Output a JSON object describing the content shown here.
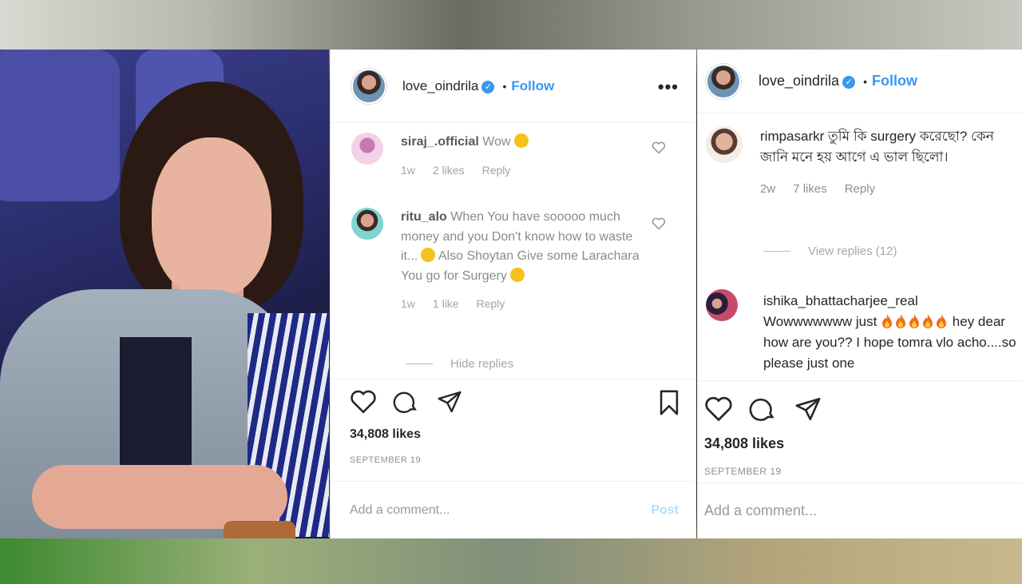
{
  "post": {
    "username": "love_oindrila",
    "follow_label": "Follow",
    "dot": "•",
    "likes": "34,808 likes",
    "date": "SEPTEMBER 19",
    "add_comment_placeholder": "Add a comment...",
    "post_label": "Post",
    "more_label": "•••",
    "verified_mark": "✓"
  },
  "left_comments": [
    {
      "user": "siraj_.official",
      "text": "Wow",
      "age": "1w",
      "likes": "2 likes",
      "reply": "Reply"
    },
    {
      "user": "ritu_alo",
      "text": "When You have sooooo much money and you Don't know how to waste it...",
      "text2": "Also Shoytan Give some Larachara You go for Surgery",
      "age": "1w",
      "likes": "1 like",
      "reply": "Reply"
    }
  ],
  "left_thread": {
    "label": "Hide replies"
  },
  "right_comments": [
    {
      "user": "rimpasarkr",
      "text": "তুমি কি surgery করেছো? কেন জানি মনে হয় আগে এ ভাল ছিলো।",
      "age": "2w",
      "likes": "7 likes",
      "reply": "Reply"
    },
    {
      "user": "ishika_bhattacharjee_real",
      "text_before": "Wowwwwwww just",
      "text_after": "hey dear how are you?? I hope tomra vlo acho....so please just one"
    }
  ],
  "right_thread": {
    "label": "View replies (12)"
  },
  "colors": {
    "accent": "#3897f0",
    "post_disabled": "#b2dffc",
    "muted": "#8e8e8e"
  },
  "icons": [
    "heart-icon",
    "comment-icon",
    "share-icon",
    "bookmark-icon",
    "more-icon",
    "verified-icon",
    "fire-emoji",
    "smile-emoji"
  ]
}
